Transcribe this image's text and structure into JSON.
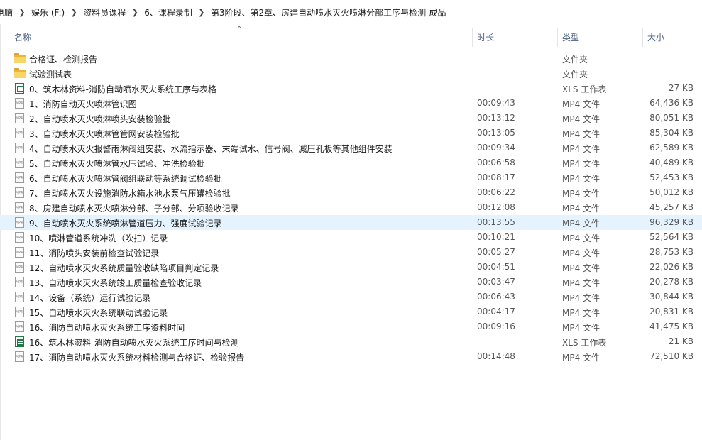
{
  "breadcrumb": [
    "电脑",
    "娱乐 (F:)",
    "资料员课程",
    "6、课程录制",
    "第3阶段、第2章、房建自动喷水灭火喷淋分部工序与检测-成品"
  ],
  "columns": {
    "name": "名称",
    "duration": "时长",
    "type": "类型",
    "size": "大小"
  },
  "files": [
    {
      "icon": "folder",
      "name": "合格证、检测报告",
      "duration": "",
      "type": "文件夹",
      "size": ""
    },
    {
      "icon": "folder",
      "name": "试验测试表",
      "duration": "",
      "type": "文件夹",
      "size": ""
    },
    {
      "icon": "xls",
      "name": "0、筑木林资料-消防自动喷水灭火系统工序与表格",
      "duration": "",
      "type": "XLS 工作表",
      "size": "27 KB"
    },
    {
      "icon": "mp4",
      "name": "1、消防自动灭火喷淋管识图",
      "duration": "00:09:43",
      "type": "MP4 文件",
      "size": "64,436 KB"
    },
    {
      "icon": "mp4",
      "name": "2、自动喷水灭火喷淋喷头安装检验批",
      "duration": "00:13:12",
      "type": "MP4 文件",
      "size": "80,051 KB"
    },
    {
      "icon": "mp4",
      "name": "3、自动喷水灭火喷淋管管网安装检验批",
      "duration": "00:13:05",
      "type": "MP4 文件",
      "size": "85,304 KB"
    },
    {
      "icon": "mp4",
      "name": "4、自动喷水灭火报警雨淋阀组安装、水流指示器、末端试水、信号阀、减压孔板等其他组件安装",
      "duration": "00:09:34",
      "type": "MP4 文件",
      "size": "62,589 KB"
    },
    {
      "icon": "mp4",
      "name": "5、自动喷水灭火喷淋管水压试验、冲洗检验批",
      "duration": "00:06:58",
      "type": "MP4 文件",
      "size": "40,489 KB"
    },
    {
      "icon": "mp4",
      "name": "6、自动喷水灭火喷淋管阀组联动等系统调试检验批",
      "duration": "00:08:17",
      "type": "MP4 文件",
      "size": "52,453 KB"
    },
    {
      "icon": "mp4",
      "name": "7、自动喷水灭火设施消防水箱水池水泵气压罐检验批",
      "duration": "00:06:22",
      "type": "MP4 文件",
      "size": "50,012 KB"
    },
    {
      "icon": "mp4",
      "name": "8、房建自动喷水灭火喷淋分部、子分部、分项验收记录",
      "duration": "00:12:08",
      "type": "MP4 文件",
      "size": "45,257 KB"
    },
    {
      "icon": "mp4",
      "name": "9、自动喷水灭火系统喷淋管道压力、强度试验记录",
      "duration": "00:13:55",
      "type": "MP4 文件",
      "size": "96,329 KB",
      "selected": true
    },
    {
      "icon": "mp4",
      "name": "10、喷淋管道系统冲洗（吹扫）记录",
      "duration": "00:10:21",
      "type": "MP4 文件",
      "size": "52,564 KB"
    },
    {
      "icon": "mp4",
      "name": "11、消防喷头安装前检查试验记录",
      "duration": "00:05:27",
      "type": "MP4 文件",
      "size": "28,753 KB"
    },
    {
      "icon": "mp4",
      "name": "12、自动喷水灭火系统质量验收缺陷项目判定记录",
      "duration": "00:04:51",
      "type": "MP4 文件",
      "size": "22,026 KB"
    },
    {
      "icon": "mp4",
      "name": "13、自动喷水灭火系统竣工质量检查验收记录",
      "duration": "00:03:47",
      "type": "MP4 文件",
      "size": "20,278 KB"
    },
    {
      "icon": "mp4",
      "name": "14、设备（系统）运行试验记录",
      "duration": "00:06:43",
      "type": "MP4 文件",
      "size": "30,844 KB"
    },
    {
      "icon": "mp4",
      "name": "15、自动喷水灭火系统联动试验记录",
      "duration": "00:04:17",
      "type": "MP4 文件",
      "size": "20,831 KB"
    },
    {
      "icon": "mp4",
      "name": "16、消防自动喷水灭火系统工序资料时间",
      "duration": "00:09:16",
      "type": "MP4 文件",
      "size": "41,475 KB"
    },
    {
      "icon": "xls",
      "name": "16、筑木林资料-消防自动喷水灭火系统工序时间与检测",
      "duration": "",
      "type": "XLS 工作表",
      "size": "21 KB"
    },
    {
      "icon": "mp4",
      "name": "17、消防自动喷水灭火系统材料检测与合格证、检验报告",
      "duration": "00:14:48",
      "type": "MP4 文件",
      "size": "72,510 KB"
    }
  ]
}
